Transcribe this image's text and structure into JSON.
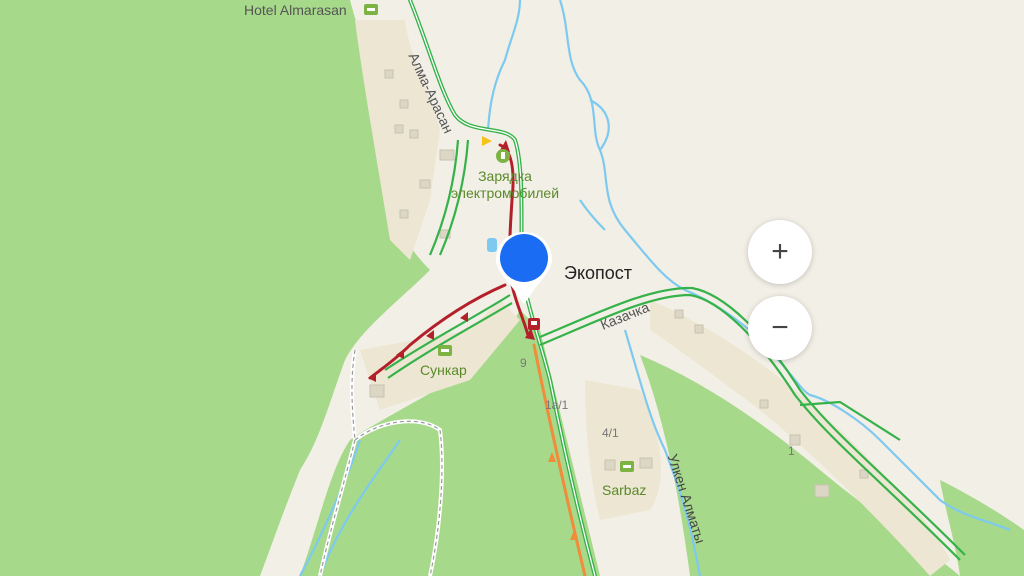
{
  "map": {
    "labels": {
      "hotel": "Hotel Almarasan",
      "road_alma_arasan": "Алма-Арасан",
      "ev_charging": "Зарядка электромобилей",
      "ekopost": "Экопост",
      "kazachka": "Казачка",
      "sunkar": "Сункар",
      "sarbaz": "Sarbaz",
      "ulken_almaty": "Улкен Алматы",
      "house_9": "9",
      "house_1a1": "1а/1",
      "house_4_1": "4/1",
      "house_1": "1"
    },
    "icons": {
      "hotel": "hotel-icon",
      "ev": "ev-charging-icon",
      "bus": "bus-stop-icon",
      "location": "location-marker-icon"
    }
  },
  "controls": {
    "zoom_in": "+",
    "zoom_out": "−"
  },
  "colors": {
    "land": "#f2efe6",
    "forest": "#a7d98a",
    "water": "#7ec9ef",
    "road_green": "#36b24a",
    "traffic_red": "#b3202a",
    "traffic_orange": "#f08c3a",
    "marker": "#1a6cf2"
  }
}
